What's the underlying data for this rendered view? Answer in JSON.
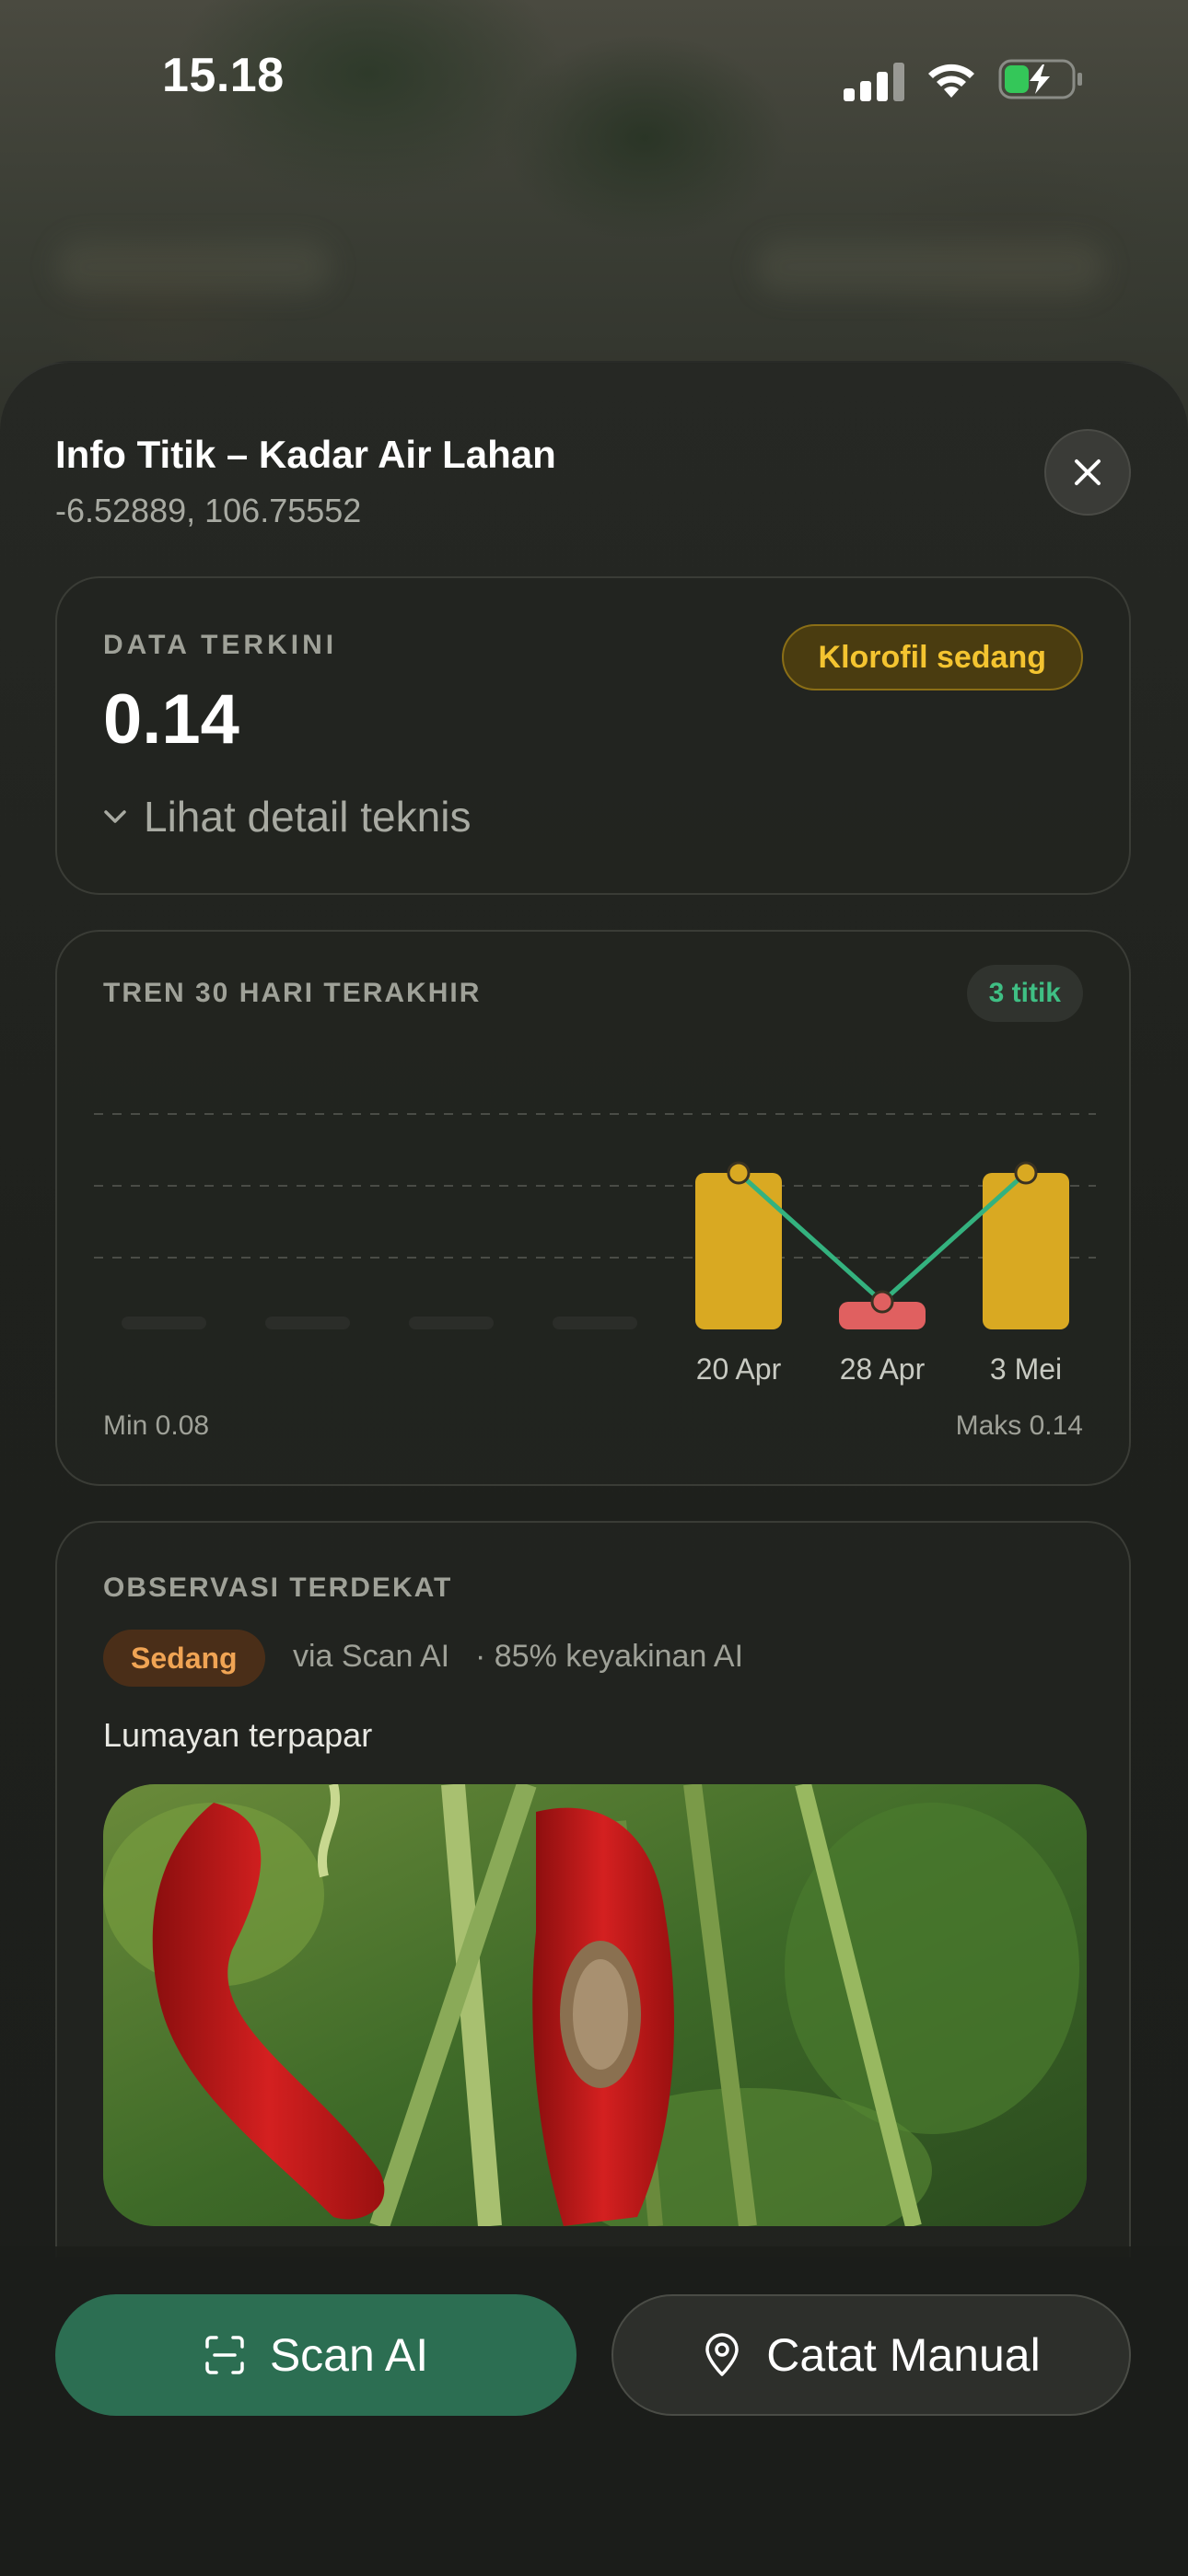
{
  "status_bar": {
    "time": "15.18",
    "battery_icon": "battery-charging-icon",
    "signal_icon": "cellular-signal-icon",
    "wifi_icon": "wifi-icon"
  },
  "header": {
    "title": "Info Titik – Kadar Air Lahan",
    "coordinates": "-6.52889, 106.75552",
    "close_icon": "close-icon"
  },
  "current_data": {
    "label": "DATA TERKINI",
    "value": "0.14",
    "badge": "Klorofil sedang",
    "detail_toggle": "Lihat detail teknis",
    "colors": {
      "badge_text": "#f4c430",
      "badge_bg": "#4a3c10"
    }
  },
  "trend": {
    "label": "TREN 30 HARI TERAKHIR",
    "count_badge": "3 titik",
    "min_label": "Min 0.08",
    "max_label": "Maks 0.14"
  },
  "chart_data": {
    "type": "bar",
    "categories": [
      "",
      "",
      "",
      "",
      "20 Apr",
      "28 Apr",
      "3 Mei"
    ],
    "values": [
      null,
      null,
      null,
      null,
      0.14,
      0.08,
      0.14
    ],
    "line_overlay": true,
    "grid": true,
    "colors": {
      "bar_high": "#d9a922",
      "bar_low": "#e06060",
      "line": "#34b27f",
      "empty": "#2b2d29"
    }
  },
  "observation": {
    "label": "OBSERVASI TERDEKAT",
    "severity": "Sedang",
    "source": "via Scan AI",
    "confidence": "· 85% keyakinan AI",
    "description": "Lumayan terpapar",
    "photo_alt": "red chili pepper with lesion"
  },
  "actions": {
    "scan_label": "Scan AI",
    "scan_icon": "scan-frame-icon",
    "manual_label": "Catat Manual",
    "manual_icon": "map-pin-icon",
    "colors": {
      "scan_bg": "#2c6e52"
    }
  }
}
